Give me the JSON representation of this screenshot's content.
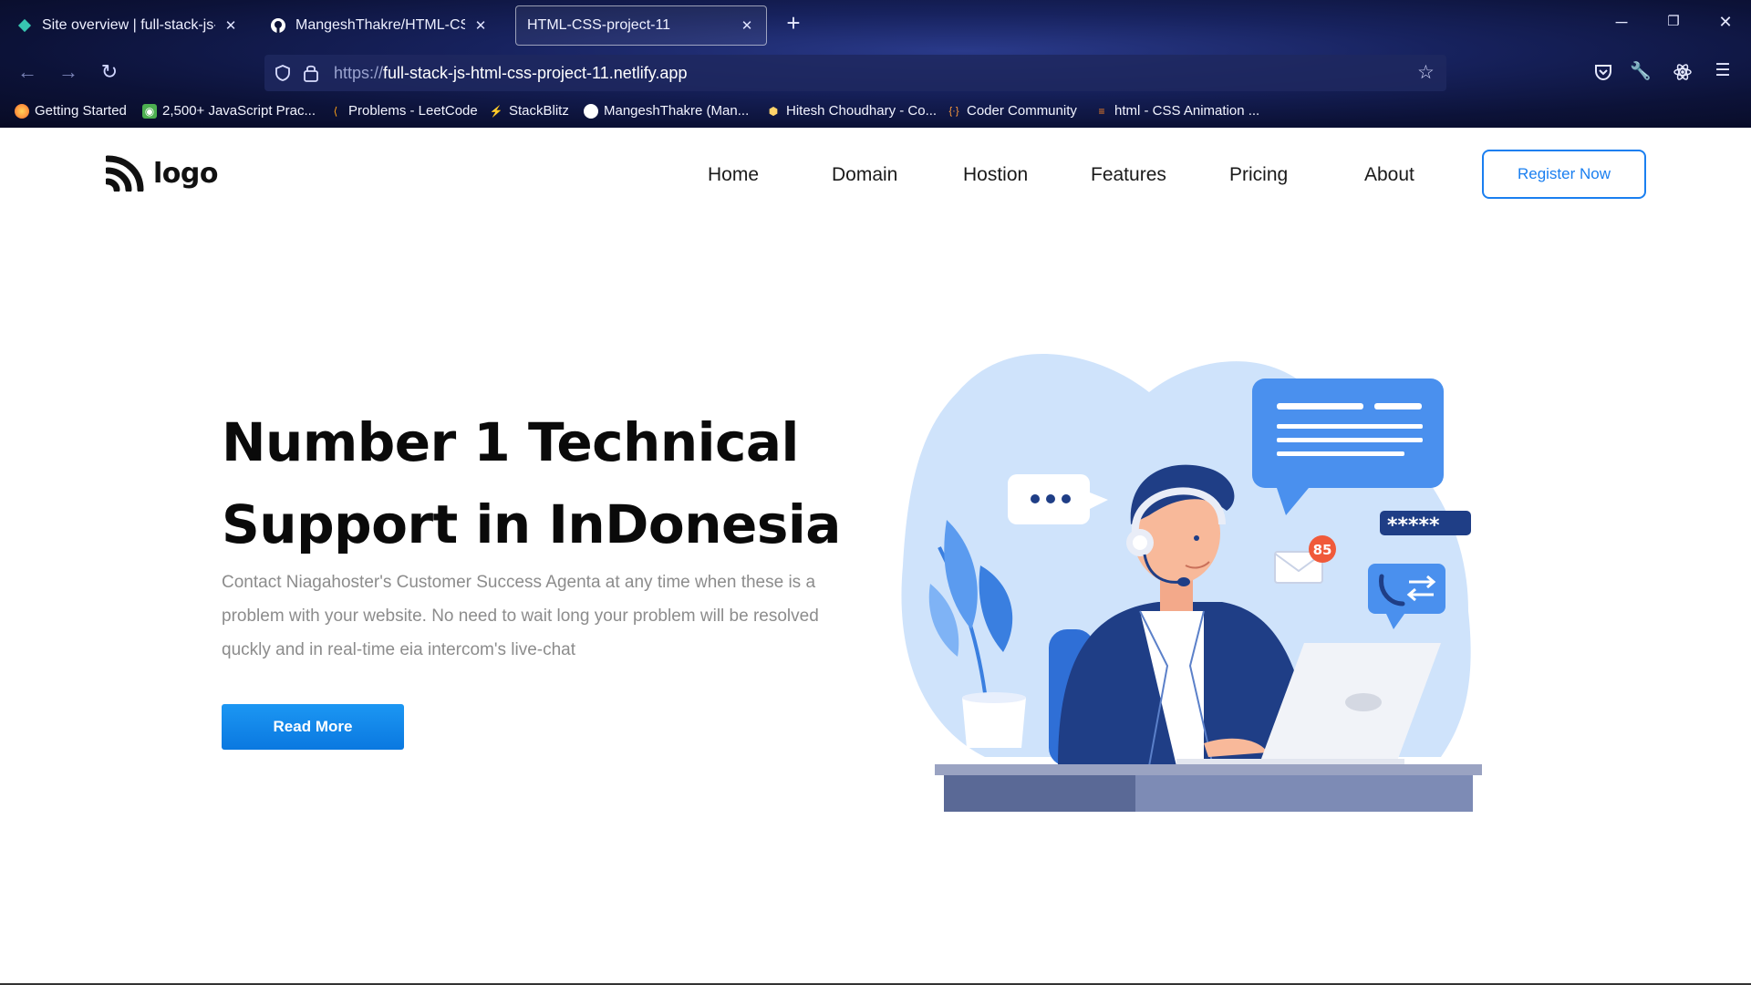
{
  "browser": {
    "tabs": [
      {
        "title": "Site overview | full-stack-js-html",
        "active": false
      },
      {
        "title": "MangeshThakre/HTML-CSS-Pro",
        "active": false
      },
      {
        "title": "HTML-CSS-project-11",
        "active": true
      }
    ],
    "url_scheme": "https://",
    "url_host": "full-stack-js-html-css-project-11.netlify.app",
    "bookmarks": [
      "Getting Started",
      "2,500+ JavaScript Prac...",
      "Problems - LeetCode",
      "StackBlitz",
      "MangeshThakre (Man...",
      "Hitesh Choudhary - Co...",
      "Coder Community",
      "html - CSS Animation ..."
    ]
  },
  "site": {
    "logo_text": "logo",
    "menu": [
      "Home",
      "Domain",
      "Hostion",
      "Features",
      "Pricing",
      "About"
    ],
    "register_label": "Register Now",
    "headline": "Number 1 Technical Support in InDonesia",
    "subtext": "Contact Niagahoster's Customer Success Agenta at any time when these is a problem with your website. No need to wait long your problem will be resolved quckly and in real-time eia intercom's live-chat",
    "read_more_label": "Read More",
    "illustration": {
      "notification_count": "85",
      "password_mask": "*****"
    }
  },
  "colors": {
    "accent": "#1a7ff0",
    "button": "#0a78e0",
    "illustration_light": "#cfe3fb",
    "illustration_mid": "#5b9bef",
    "illustration_dark": "#1f3e86",
    "badge": "#f05a3a"
  },
  "icons": {
    "back": "arrow-left-icon",
    "forward": "arrow-right-icon",
    "reload": "reload-icon",
    "shield": "shield-icon",
    "lock": "lock-icon",
    "star": "bookmark-star-icon",
    "pocket": "pocket-icon",
    "tools": "wrench-icon",
    "extension": "react-icon",
    "menu": "hamburger-menu-icon"
  }
}
